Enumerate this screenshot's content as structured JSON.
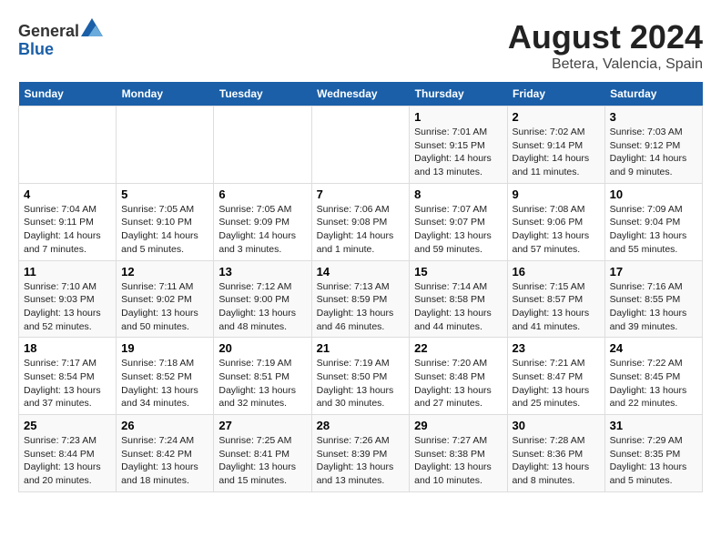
{
  "header": {
    "logo_general": "General",
    "logo_blue": "Blue",
    "title": "August 2024",
    "subtitle": "Betera, Valencia, Spain"
  },
  "calendar": {
    "weekdays": [
      "Sunday",
      "Monday",
      "Tuesday",
      "Wednesday",
      "Thursday",
      "Friday",
      "Saturday"
    ],
    "weeks": [
      [
        {
          "day": "",
          "info": ""
        },
        {
          "day": "",
          "info": ""
        },
        {
          "day": "",
          "info": ""
        },
        {
          "day": "",
          "info": ""
        },
        {
          "day": "1",
          "info": "Sunrise: 7:01 AM\nSunset: 9:15 PM\nDaylight: 14 hours and 13 minutes."
        },
        {
          "day": "2",
          "info": "Sunrise: 7:02 AM\nSunset: 9:14 PM\nDaylight: 14 hours and 11 minutes."
        },
        {
          "day": "3",
          "info": "Sunrise: 7:03 AM\nSunset: 9:12 PM\nDaylight: 14 hours and 9 minutes."
        }
      ],
      [
        {
          "day": "4",
          "info": "Sunrise: 7:04 AM\nSunset: 9:11 PM\nDaylight: 14 hours and 7 minutes."
        },
        {
          "day": "5",
          "info": "Sunrise: 7:05 AM\nSunset: 9:10 PM\nDaylight: 14 hours and 5 minutes."
        },
        {
          "day": "6",
          "info": "Sunrise: 7:05 AM\nSunset: 9:09 PM\nDaylight: 14 hours and 3 minutes."
        },
        {
          "day": "7",
          "info": "Sunrise: 7:06 AM\nSunset: 9:08 PM\nDaylight: 14 hours and 1 minute."
        },
        {
          "day": "8",
          "info": "Sunrise: 7:07 AM\nSunset: 9:07 PM\nDaylight: 13 hours and 59 minutes."
        },
        {
          "day": "9",
          "info": "Sunrise: 7:08 AM\nSunset: 9:06 PM\nDaylight: 13 hours and 57 minutes."
        },
        {
          "day": "10",
          "info": "Sunrise: 7:09 AM\nSunset: 9:04 PM\nDaylight: 13 hours and 55 minutes."
        }
      ],
      [
        {
          "day": "11",
          "info": "Sunrise: 7:10 AM\nSunset: 9:03 PM\nDaylight: 13 hours and 52 minutes."
        },
        {
          "day": "12",
          "info": "Sunrise: 7:11 AM\nSunset: 9:02 PM\nDaylight: 13 hours and 50 minutes."
        },
        {
          "day": "13",
          "info": "Sunrise: 7:12 AM\nSunset: 9:00 PM\nDaylight: 13 hours and 48 minutes."
        },
        {
          "day": "14",
          "info": "Sunrise: 7:13 AM\nSunset: 8:59 PM\nDaylight: 13 hours and 46 minutes."
        },
        {
          "day": "15",
          "info": "Sunrise: 7:14 AM\nSunset: 8:58 PM\nDaylight: 13 hours and 44 minutes."
        },
        {
          "day": "16",
          "info": "Sunrise: 7:15 AM\nSunset: 8:57 PM\nDaylight: 13 hours and 41 minutes."
        },
        {
          "day": "17",
          "info": "Sunrise: 7:16 AM\nSunset: 8:55 PM\nDaylight: 13 hours and 39 minutes."
        }
      ],
      [
        {
          "day": "18",
          "info": "Sunrise: 7:17 AM\nSunset: 8:54 PM\nDaylight: 13 hours and 37 minutes."
        },
        {
          "day": "19",
          "info": "Sunrise: 7:18 AM\nSunset: 8:52 PM\nDaylight: 13 hours and 34 minutes."
        },
        {
          "day": "20",
          "info": "Sunrise: 7:19 AM\nSunset: 8:51 PM\nDaylight: 13 hours and 32 minutes."
        },
        {
          "day": "21",
          "info": "Sunrise: 7:19 AM\nSunset: 8:50 PM\nDaylight: 13 hours and 30 minutes."
        },
        {
          "day": "22",
          "info": "Sunrise: 7:20 AM\nSunset: 8:48 PM\nDaylight: 13 hours and 27 minutes."
        },
        {
          "day": "23",
          "info": "Sunrise: 7:21 AM\nSunset: 8:47 PM\nDaylight: 13 hours and 25 minutes."
        },
        {
          "day": "24",
          "info": "Sunrise: 7:22 AM\nSunset: 8:45 PM\nDaylight: 13 hours and 22 minutes."
        }
      ],
      [
        {
          "day": "25",
          "info": "Sunrise: 7:23 AM\nSunset: 8:44 PM\nDaylight: 13 hours and 20 minutes."
        },
        {
          "day": "26",
          "info": "Sunrise: 7:24 AM\nSunset: 8:42 PM\nDaylight: 13 hours and 18 minutes."
        },
        {
          "day": "27",
          "info": "Sunrise: 7:25 AM\nSunset: 8:41 PM\nDaylight: 13 hours and 15 minutes."
        },
        {
          "day": "28",
          "info": "Sunrise: 7:26 AM\nSunset: 8:39 PM\nDaylight: 13 hours and 13 minutes."
        },
        {
          "day": "29",
          "info": "Sunrise: 7:27 AM\nSunset: 8:38 PM\nDaylight: 13 hours and 10 minutes."
        },
        {
          "day": "30",
          "info": "Sunrise: 7:28 AM\nSunset: 8:36 PM\nDaylight: 13 hours and 8 minutes."
        },
        {
          "day": "31",
          "info": "Sunrise: 7:29 AM\nSunset: 8:35 PM\nDaylight: 13 hours and 5 minutes."
        }
      ]
    ]
  }
}
